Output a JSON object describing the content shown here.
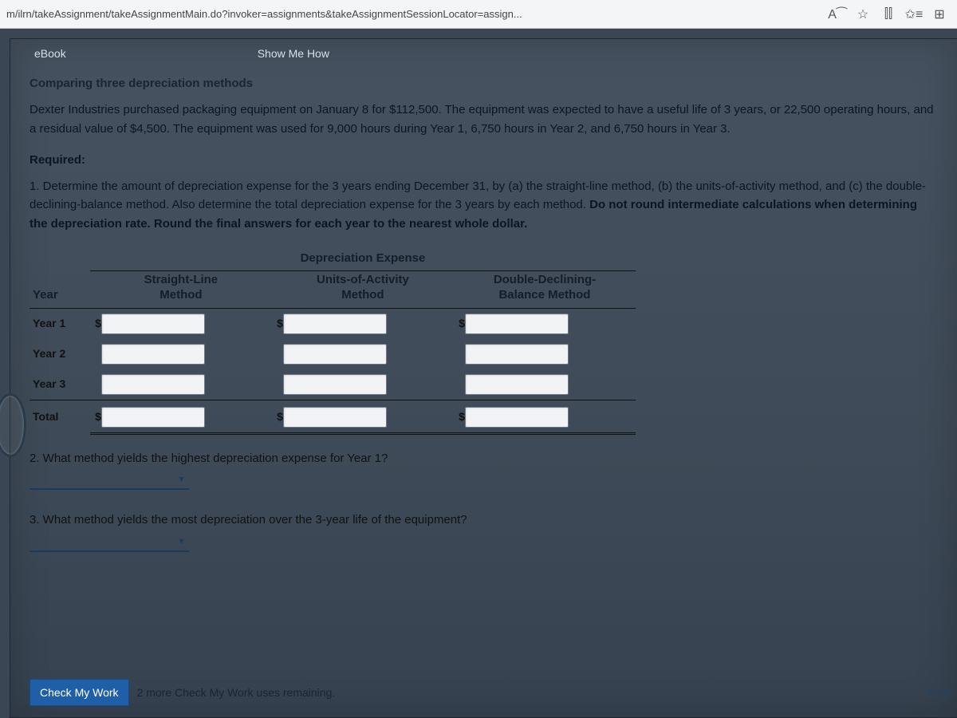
{
  "browser": {
    "url": "m/ilrn/takeAssignment/takeAssignmentMain.do?invoker=assignments&takeAssignmentSessionLocator=assign...",
    "icons": {
      "readaloud": "A⁀",
      "star": "☆",
      "split": "⫿⫿",
      "collections": "✩≡",
      "app": "⊞"
    }
  },
  "links": {
    "ebook": "eBook",
    "showme": "Show Me How"
  },
  "title": "Comparing three depreciation methods",
  "para1": "Dexter Industries purchased packaging equipment on January 8 for $112,500. The equipment was expected to have a useful life of 3 years, or 22,500 operating hours, and a residual value of $4,500. The equipment was used for 9,000 hours during Year 1, 6,750 hours in Year 2, and 6,750 hours in Year 3.",
  "required": "Required:",
  "para2a": "1.  Determine the amount of depreciation expense for the 3 years ending December 31, by (a) the straight-line method, (b) the units-of-activity method, and (c) the double-declining-balance method. Also determine the total depreciation expense for the 3 years by each method. ",
  "para2b": "Do not round intermediate calculations when determining the depreciation rate. Round the final answers for each year to the nearest whole dollar.",
  "table": {
    "group_header": "Depreciation Expense",
    "year_label": "Year",
    "cols": {
      "sl1": "Straight-Line",
      "sl2": "Method",
      "ua1": "Units-of-Activity",
      "ua2": "Method",
      "dd1": "Double-Declining-",
      "dd2": "Balance Method"
    },
    "rows": [
      "Year 1",
      "Year 2",
      "Year 3"
    ],
    "total": "Total",
    "dollar": "$"
  },
  "q2": "2.  What method yields the highest depreciation expense for Year 1?",
  "q3": "3.  What method yields the most depreciation over the 3-year life of the equipment?",
  "footer": {
    "check": "Check My Work",
    "remaining": "2 more Check My Work uses remaining.",
    "next": "Next"
  }
}
